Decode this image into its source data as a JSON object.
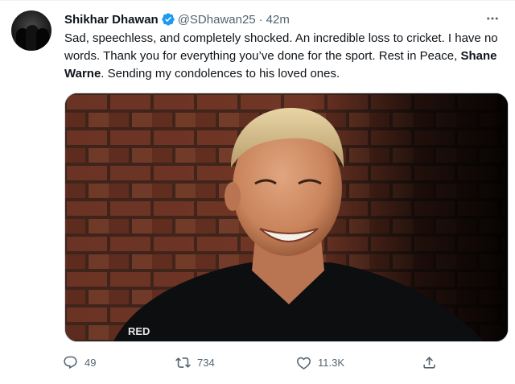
{
  "tweet": {
    "author_name": "Shikhar Dhawan",
    "handle": "@SDhawan25",
    "separator": "·",
    "time": "42m",
    "text_part1": "Sad, speechless, and completely shocked. An incredible loss to cricket. I have no words. Thank you for everything you’ve done for the sport. Rest in Peace, ",
    "text_bold": "Shane Warne",
    "text_part2": ". Sending my condolences to his loved ones.",
    "photo_logo": "RED"
  },
  "actions": {
    "replies": "49",
    "retweets": "734",
    "likes": "11.3K"
  },
  "icons": {
    "verified": "verified-badge-icon",
    "more": "more-horizontal-icon",
    "reply": "reply-icon",
    "retweet": "retweet-icon",
    "like": "heart-icon",
    "share": "share-icon"
  },
  "colors": {
    "verified": "#1d9bf0",
    "secondary_text": "#536471",
    "primary_text": "#0f1419"
  }
}
